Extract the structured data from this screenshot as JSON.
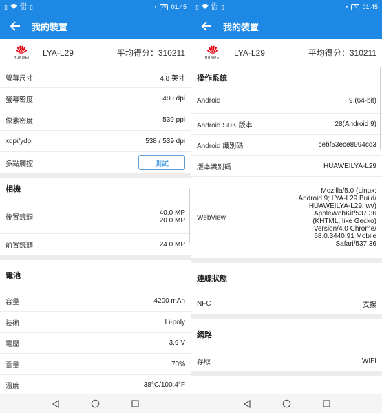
{
  "status": {
    "left_speed_value": "261",
    "left_speed_unit": "B/s",
    "right_speed_value": "291",
    "right_speed_unit": "B/s",
    "battery": "70",
    "time": "01:45"
  },
  "app": {
    "title": "我的裝置"
  },
  "device": {
    "model": "LYA-L29",
    "score": "平均得分：310211",
    "brand": "HUAWEI"
  },
  "left": {
    "rows_top": [
      {
        "label": "螢幕尺寸",
        "value": "4.8 英寸"
      },
      {
        "label": "螢幕密度",
        "value": "480 dpi"
      },
      {
        "label": "像素密度",
        "value": "539 ppi"
      },
      {
        "label": "xdpi/ydpi",
        "value": "538 / 539 dpi"
      }
    ],
    "multitouch": {
      "label": "多點觸控",
      "button": "測試"
    },
    "camera": {
      "title": "相機",
      "rear_label": "後置鏡頭",
      "rear_value_1": "40.0 MP",
      "rear_value_2": "20.0 MP",
      "front_label": "前置鏡頭",
      "front_value": "24.0 MP"
    },
    "battery": {
      "title": "電池",
      "rows": [
        {
          "label": "容量",
          "value": "4200 mAh"
        },
        {
          "label": "技術",
          "value": "Li-poly"
        },
        {
          "label": "電壓",
          "value": "3.9 V"
        },
        {
          "label": "電量",
          "value": "70%"
        },
        {
          "label": "溫度",
          "value": "38°C/100.4°F"
        }
      ]
    }
  },
  "right": {
    "os": {
      "title": "操作系統",
      "rows": [
        {
          "label": "Android",
          "value": "9 (64-bit)"
        },
        {
          "label": "Android SDK 版本",
          "value": "28(Android 9)"
        },
        {
          "label": "Android 識別碼",
          "value": "cebf53ece8994cd3"
        },
        {
          "label": "版本識別碼",
          "value": "HUAWEILYA-L29"
        }
      ],
      "webview_label": "WebView",
      "webview_lines": [
        "Mozilla/5.0 (Linux;",
        "Android 9; LYA-L29 Build/",
        "HUAWEILYA-L29; wv)",
        "AppleWebKit/537.36",
        "(KHTML, like Gecko)",
        "Version/4.0 Chrome/",
        "68.0.3440.91 Mobile",
        "Safari/537.36"
      ]
    },
    "connection": {
      "title": "連線狀態",
      "label": "NFC",
      "value": "支援"
    },
    "network": {
      "title": "網路",
      "label": "存取",
      "value": "WIFI"
    }
  },
  "colors": {
    "primary": "#1e88e5",
    "huawei_red": "#e60012"
  },
  "icons": [
    "wifi-icon",
    "vibrate-icon",
    "nfc-icon",
    "battery-icon",
    "back-arrow-icon",
    "nav-back-icon",
    "nav-home-icon",
    "nav-recents-icon",
    "huawei-logo-icon"
  ]
}
